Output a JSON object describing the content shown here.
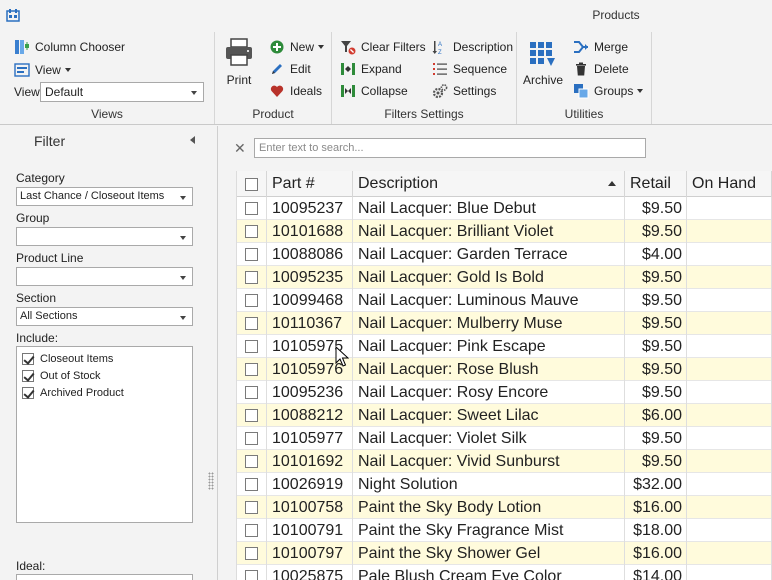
{
  "window": {
    "title": "Products"
  },
  "ribbon": {
    "views": {
      "caption": "Views",
      "column_chooser": "Column Chooser",
      "view_menu": "View",
      "view_label": "View",
      "view_value": "Default"
    },
    "product": {
      "caption": "Product",
      "print": "Print",
      "new": "New",
      "edit": "Edit",
      "ideals": "Ideals"
    },
    "filters_settings": {
      "caption": "Filters  Settings",
      "clear_filters": "Clear Filters",
      "expand": "Expand",
      "collapse": "Collapse",
      "description": "Description",
      "sequence": "Sequence",
      "settings": "Settings"
    },
    "utilities": {
      "caption": "Utilities",
      "archive": "Archive",
      "merge": "Merge",
      "delete": "Delete",
      "groups": "Groups"
    }
  },
  "filter": {
    "title": "Filter",
    "category_label": "Category",
    "category_value": "Last Chance / Closeout Items",
    "group_label": "Group",
    "group_value": "",
    "product_line_label": "Product Line",
    "product_line_value": "",
    "section_label": "Section",
    "section_value": "All Sections",
    "include_label": "Include:",
    "include_items": [
      {
        "label": "Closeout Items",
        "checked": true
      },
      {
        "label": "Out of Stock",
        "checked": true
      },
      {
        "label": "Archived Product",
        "checked": true
      }
    ],
    "ideal_label": "Ideal:"
  },
  "search": {
    "placeholder": "Enter text to search..."
  },
  "grid": {
    "columns": {
      "part": "Part #",
      "description": "Description",
      "retail": "Retail",
      "on_hand": "On Hand"
    },
    "rows": [
      {
        "part": "10095237",
        "description": "Nail Lacquer: Blue Debut",
        "retail": "$9.50",
        "on_hand": ""
      },
      {
        "part": "10101688",
        "description": "Nail Lacquer: Brilliant Violet",
        "retail": "$9.50",
        "on_hand": ""
      },
      {
        "part": "10088086",
        "description": "Nail Lacquer: Garden Terrace",
        "retail": "$4.00",
        "on_hand": ""
      },
      {
        "part": "10095235",
        "description": "Nail Lacquer: Gold Is Bold",
        "retail": "$9.50",
        "on_hand": ""
      },
      {
        "part": "10099468",
        "description": "Nail Lacquer: Luminous Mauve",
        "retail": "$9.50",
        "on_hand": ""
      },
      {
        "part": "10110367",
        "description": "Nail Lacquer: Mulberry Muse",
        "retail": "$9.50",
        "on_hand": ""
      },
      {
        "part": "10105975",
        "description": "Nail Lacquer: Pink Escape",
        "retail": "$9.50",
        "on_hand": ""
      },
      {
        "part": "10105976",
        "description": "Nail Lacquer: Rose Blush",
        "retail": "$9.50",
        "on_hand": ""
      },
      {
        "part": "10095236",
        "description": "Nail Lacquer: Rosy Encore",
        "retail": "$9.50",
        "on_hand": ""
      },
      {
        "part": "10088212",
        "description": "Nail Lacquer: Sweet Lilac",
        "retail": "$6.00",
        "on_hand": ""
      },
      {
        "part": "10105977",
        "description": "Nail Lacquer: Violet Silk",
        "retail": "$9.50",
        "on_hand": ""
      },
      {
        "part": "10101692",
        "description": "Nail Lacquer: Vivid Sunburst",
        "retail": "$9.50",
        "on_hand": ""
      },
      {
        "part": "10026919",
        "description": "Night Solution",
        "retail": "$32.00",
        "on_hand": ""
      },
      {
        "part": "10100758",
        "description": "Paint the Sky Body Lotion",
        "retail": "$16.00",
        "on_hand": ""
      },
      {
        "part": "10100791",
        "description": "Paint the Sky Fragrance Mist",
        "retail": "$18.00",
        "on_hand": ""
      },
      {
        "part": "10100797",
        "description": "Paint the Sky Shower Gel",
        "retail": "$16.00",
        "on_hand": ""
      },
      {
        "part": "10025875",
        "description": "Pale Blush Cream Eye Color",
        "retail": "$14.00",
        "on_hand": ""
      }
    ]
  },
  "colors": {
    "alt_row": "#fffbdc",
    "accent_blue": "#1f5fa8",
    "ribbon_bg": "#f3f3f3"
  }
}
